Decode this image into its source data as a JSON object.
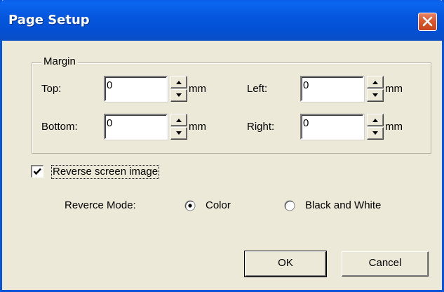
{
  "window": {
    "title": "Page Setup",
    "close_icon": "close-x-icon"
  },
  "margin": {
    "group_title": "Margin",
    "top": {
      "label": "Top:",
      "value": "0",
      "unit": "mm"
    },
    "left": {
      "label": "Left:",
      "value": "0",
      "unit": "mm"
    },
    "bottom": {
      "label": "Bottom:",
      "value": "0",
      "unit": "mm"
    },
    "right": {
      "label": "Right:",
      "value": "0",
      "unit": "mm"
    }
  },
  "reverse": {
    "checkbox_label": "Reverse screen image",
    "checked": true,
    "mode_label": "Reverce Mode:",
    "options": [
      {
        "label": "Color",
        "selected": true
      },
      {
        "label": "Black and White",
        "selected": false
      }
    ]
  },
  "buttons": {
    "ok": "OK",
    "cancel": "Cancel"
  }
}
